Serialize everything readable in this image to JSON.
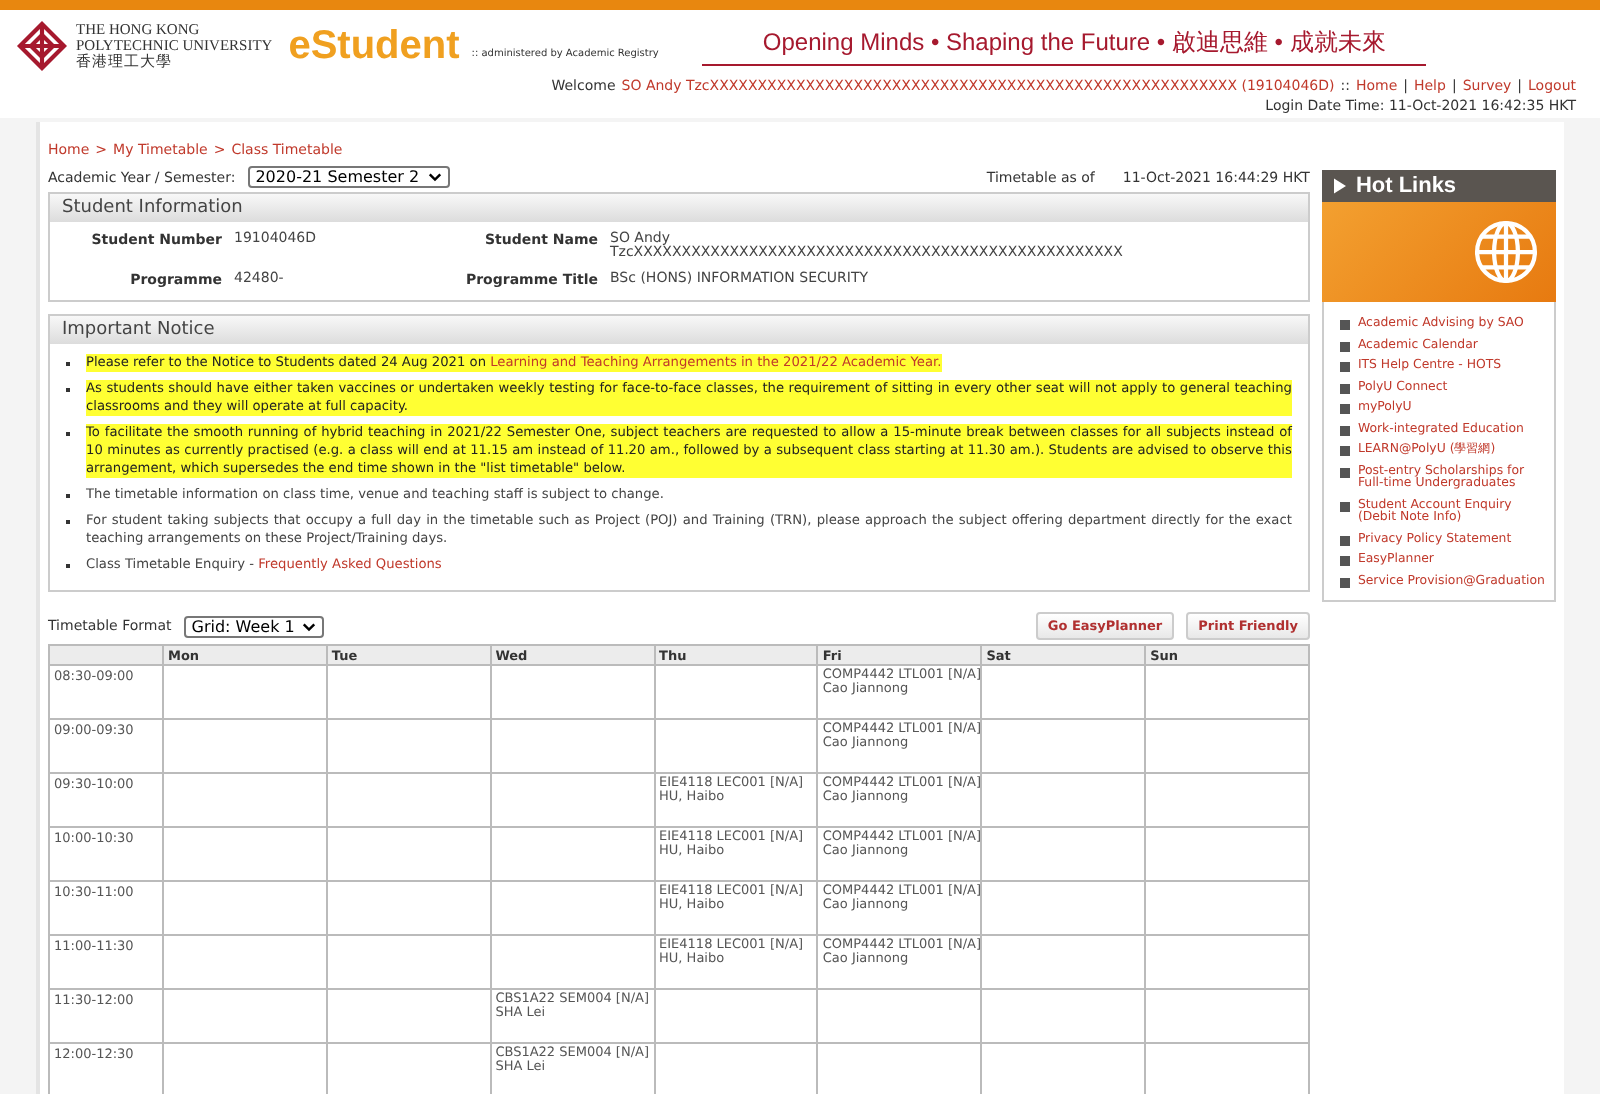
{
  "header": {
    "university_en_1": "THE HONG KONG",
    "university_en_2": "POLYTECHNIC UNIVERSITY",
    "university_zh": "香港理工大學",
    "app_name": "eStudent",
    "administered": ":: administered by Academic Registry",
    "slogan": "Opening Minds • Shaping the Future • 啟迪思維 • 成就未來"
  },
  "user_bar": {
    "welcome": "Welcome",
    "user": "SO Andy TzcXXXXXXXXXXXXXXXXXXXXXXXXXXXXXXXXXXXXXXXXXXXXXXXXXXXXXXX (19104046D)",
    "separator": "::",
    "links": [
      "Home",
      "Help",
      "Survey",
      "Logout"
    ],
    "link_separator": "|",
    "login_time": "Login Date Time: 11-Oct-2021 16:42:35 HKT"
  },
  "breadcrumb": {
    "separator": ">",
    "items": [
      "Home",
      "My Timetable",
      "Class Timetable"
    ]
  },
  "semester": {
    "label": "Academic Year / Semester:",
    "value": "2020-21 Semester 2"
  },
  "timetable_as_of": {
    "label": "Timetable as of",
    "value": "11-Oct-2021 16:44:29 HKT"
  },
  "student_info": {
    "title": "Student Information",
    "fields": [
      {
        "label": "Student Number",
        "value": "19104046D"
      },
      {
        "label": "Student Name",
        "value": "SO Andy",
        "value_2": "TzcXXXXXXXXXXXXXXXXXXXXXXXXXXXXXXXXXXXXXXXXXXXXXXXXXXX"
      },
      {
        "label": "Programme",
        "value": "42480-"
      },
      {
        "label": "Programme Title",
        "value": "BSc (HONS) INFORMATION SECURITY"
      }
    ]
  },
  "notice": {
    "title": "Important Notice",
    "items": [
      {
        "text": "Please refer to the Notice to Students dated 24 Aug 2021 on ",
        "link": "Learning and Teaching Arrangements in the 2021/22 Academic Year.",
        "highlighted": true
      },
      {
        "text": "As students should have either taken vaccines or undertaken weekly testing for face-to-face classes, the requirement of sitting in every other seat will not apply to general teaching classrooms and they will operate at full capacity.",
        "highlighted": true
      },
      {
        "text": "To facilitate the smooth running of hybrid teaching in 2021/22 Semester One, subject teachers are requested to allow a 15-minute break between classes for all subjects instead of 10 minutes as currently practised (e.g. a class will end at 11.15 am instead of 11.20 am., followed by a subsequent class starting at 11.30 am.). Students are advised to observe this arrangement, which supersedes the end time shown in the \"list timetable\" below.",
        "highlighted": true
      },
      {
        "text": "The timetable information on class time, venue and teaching staff is subject to change.",
        "highlighted": false
      },
      {
        "text": "For student taking subjects that occupy a full day in the timetable such as Project (POJ) and Training (TRN), please approach the subject offering department directly for the exact teaching arrangements on these Project/Training days.",
        "highlighted": false
      },
      {
        "text": "Class Timetable Enquiry - ",
        "link": "Frequently Asked Questions",
        "highlighted": false
      }
    ]
  },
  "timetable": {
    "format_label": "Timetable Format",
    "format_value": "Grid: Week 1",
    "buttons": [
      "Go EasyPlanner",
      "Print Friendly"
    ],
    "columns": [
      "Mon",
      "Tue",
      "Wed",
      "Thu",
      "Fri",
      "Sat",
      "Sun"
    ],
    "rows": [
      {
        "time": "08:30-09:00",
        "cells": [
          null,
          null,
          null,
          null,
          {
            "course": "COMP4442 LTL001 [N/A]",
            "teacher": "Cao Jiannong"
          },
          null,
          null
        ]
      },
      {
        "time": "09:00-09:30",
        "cells": [
          null,
          null,
          null,
          null,
          {
            "course": "COMP4442 LTL001 [N/A]",
            "teacher": "Cao Jiannong"
          },
          null,
          null
        ]
      },
      {
        "time": "09:30-10:00",
        "cells": [
          null,
          null,
          null,
          {
            "course": "EIE4118 LEC001 [N/A]",
            "teacher": "HU, Haibo"
          },
          {
            "course": "COMP4442 LTL001 [N/A]",
            "teacher": "Cao Jiannong"
          },
          null,
          null
        ]
      },
      {
        "time": "10:00-10:30",
        "cells": [
          null,
          null,
          null,
          {
            "course": "EIE4118 LEC001 [N/A]",
            "teacher": "HU, Haibo"
          },
          {
            "course": "COMP4442 LTL001 [N/A]",
            "teacher": "Cao Jiannong"
          },
          null,
          null
        ]
      },
      {
        "time": "10:30-11:00",
        "cells": [
          null,
          null,
          null,
          {
            "course": "EIE4118 LEC001 [N/A]",
            "teacher": "HU, Haibo"
          },
          {
            "course": "COMP4442 LTL001 [N/A]",
            "teacher": "Cao Jiannong"
          },
          null,
          null
        ]
      },
      {
        "time": "11:00-11:30",
        "cells": [
          null,
          null,
          null,
          {
            "course": "EIE4118 LEC001 [N/A]",
            "teacher": "HU, Haibo"
          },
          {
            "course": "COMP4442 LTL001 [N/A]",
            "teacher": "Cao Jiannong"
          },
          null,
          null
        ]
      },
      {
        "time": "11:30-12:00",
        "cells": [
          null,
          null,
          {
            "course": "CBS1A22 SEM004 [N/A]",
            "teacher": "SHA Lei"
          },
          null,
          null,
          null,
          null
        ]
      },
      {
        "time": "12:00-12:30",
        "cells": [
          null,
          null,
          {
            "course": "CBS1A22 SEM004 [N/A]",
            "teacher": "SHA Lei"
          },
          null,
          null,
          null,
          null
        ]
      }
    ]
  },
  "hot_links": {
    "title": "Hot Links",
    "items": [
      "Academic Advising by SAO",
      "Academic Calendar",
      "ITS Help Centre - HOTS",
      "PolyU Connect",
      "myPolyU",
      "Work-integrated Education",
      "LEARN@PolyU (學習網)",
      "Post-entry Scholarships for Full-time Undergraduates",
      "Student Account Enquiry (Debit Note Info)",
      "Privacy Policy Statement",
      "EasyPlanner",
      "Service Provision@Graduation"
    ]
  }
}
